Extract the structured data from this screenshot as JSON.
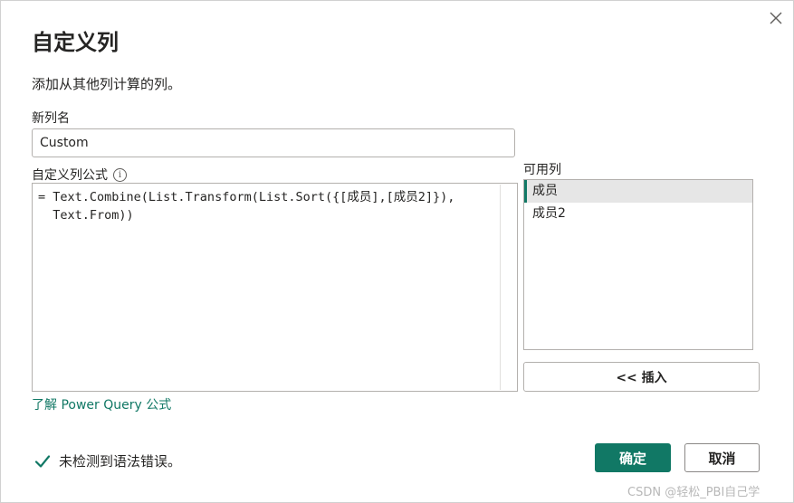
{
  "dialog": {
    "title": "自定义列",
    "subtitle": "添加从其他列计算的列。",
    "close_icon": "close-icon"
  },
  "new_column": {
    "label": "新列名",
    "value": "Custom"
  },
  "formula": {
    "label": "自定义列公式",
    "info_icon": "info-icon",
    "line1": "= Text.Combine(List.Transform(List.Sort({[成员],[成员2]}),",
    "line2": "  Text.From))"
  },
  "available_columns": {
    "label": "可用列",
    "items": [
      {
        "label": "成员",
        "selected": true
      },
      {
        "label": "成员2",
        "selected": false
      }
    ]
  },
  "insert_button": {
    "label": "<< 插入"
  },
  "learn_link": {
    "label": "了解 Power Query 公式"
  },
  "status": {
    "icon": "checkmark-icon",
    "text": "未检测到语法错误。"
  },
  "buttons": {
    "ok": "确定",
    "cancel": "取消"
  },
  "watermark": "CSDN @轻松_PBI自己学",
  "colors": {
    "accent": "#117865",
    "text": "#252423",
    "border": "#b3b0ad",
    "selected_bg": "#e6e6e6"
  }
}
